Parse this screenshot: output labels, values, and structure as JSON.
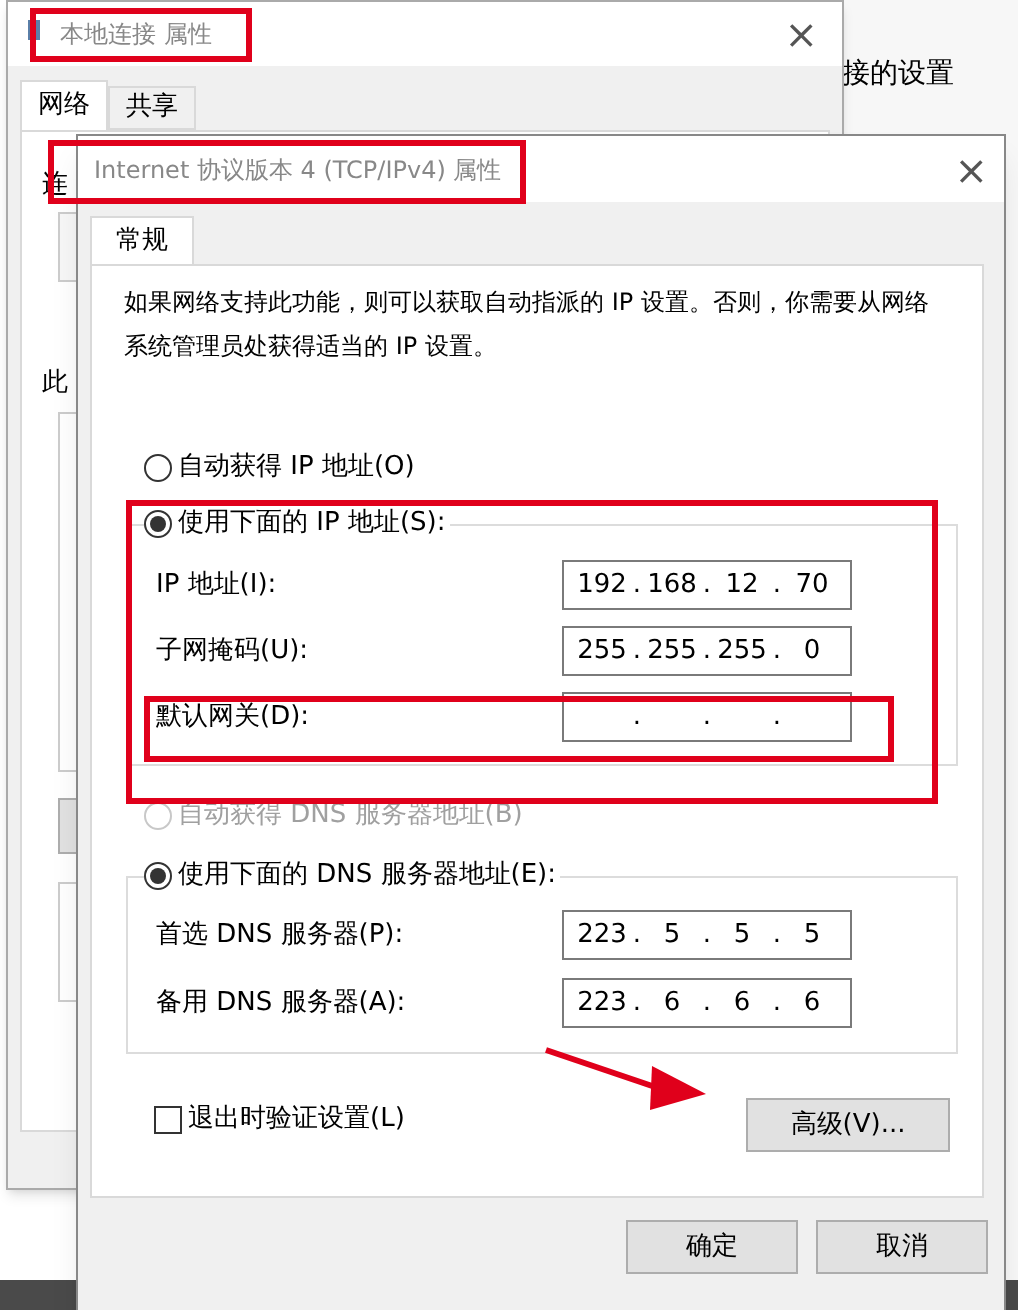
{
  "background": {
    "text": "接的设置"
  },
  "back_window": {
    "title": "本地连接 属性",
    "close": "×",
    "tabs": [
      {
        "label": "网络",
        "selected": true
      },
      {
        "label": "共享",
        "selected": false
      }
    ],
    "fragments": [
      "连",
      "此"
    ]
  },
  "dialog": {
    "title": "Internet 协议版本 4 (TCP/IPv4) 属性",
    "close": "×",
    "tabs": [
      {
        "label": "常规",
        "selected": true
      }
    ],
    "description": "如果网络支持此功能，则可以获取自动指派的 IP 设置。否则，你需要从网络系统管理员处获得适当的 IP 设置。",
    "octet_separator": ".",
    "ip_mode": [
      {
        "label": "自动获得 IP 地址(O)",
        "selected": false,
        "disabled": false
      },
      {
        "label": "使用下面的 IP 地址(S):",
        "selected": true,
        "disabled": false
      }
    ],
    "ip_fields": [
      {
        "label": "IP 地址(I):",
        "octets": [
          "192",
          "168",
          "12",
          "70"
        ]
      },
      {
        "label": "子网掩码(U):",
        "octets": [
          "255",
          "255",
          "255",
          "0"
        ]
      },
      {
        "label": "默认网关(D):"
      }
    ],
    "dns_mode": [
      {
        "label": "自动获得 DNS 服务器地址(B)",
        "selected": false,
        "disabled": true
      },
      {
        "label": "使用下面的 DNS 服务器地址(E):",
        "selected": true,
        "disabled": false
      }
    ],
    "dns_fields": [
      {
        "label": "首选 DNS 服务器(P):",
        "octets": [
          "223",
          "5",
          "5",
          "5"
        ]
      },
      {
        "label": "备用 DNS 服务器(A):",
        "octets": [
          "223",
          "6",
          "6",
          "6"
        ]
      }
    ],
    "validate": {
      "label": "退出时验证设置(L)",
      "checked": false
    },
    "advanced_button": "高级(V)...",
    "buttons": [
      "确定",
      "取消"
    ]
  }
}
